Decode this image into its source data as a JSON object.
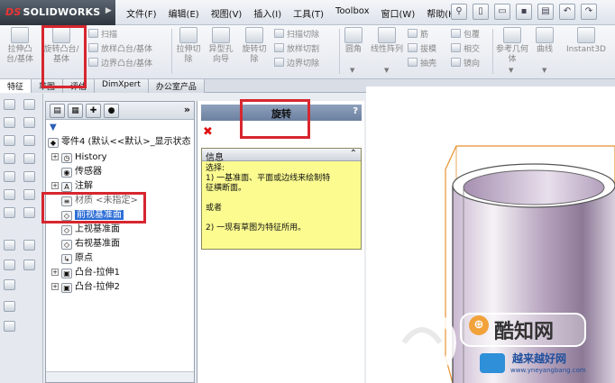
{
  "app": {
    "logo_prefix": "DS",
    "logo_text": "SOLIDWORKS"
  },
  "menu": [
    "文件(F)",
    "编辑(E)",
    "视图(V)",
    "插入(I)",
    "工具(T)",
    "Toolbox",
    "窗口(W)",
    "帮助(H)"
  ],
  "ribbon": {
    "extrude_boss": "拉伸凸台/基体",
    "revolve_boss": "旋转凸台/基体",
    "sweep": "扫描",
    "loft": "放样凸台/基体",
    "boundary_boss": "边界凸台/基体",
    "extrude_cut": "拉伸切除",
    "hole_wizard": "异型孔向导",
    "revolve_cut": "旋转切除",
    "sweep_cut": "扫描切除",
    "loft_cut": "放样切割",
    "boundary_cut": "边界切除",
    "fillet": "圆角",
    "linear_pattern": "线性阵列",
    "rib": "筋",
    "draft": "拔模",
    "shell": "抽壳",
    "wrap": "包覆",
    "intersect": "相交",
    "mirror": "镜向",
    "ref_geometry": "参考几何体",
    "curves": "曲线",
    "instant3d": "Instant3D"
  },
  "tabs": [
    "特征",
    "草图",
    "评估",
    "DimXpert",
    "办公室产品"
  ],
  "feature_manager": {
    "root": "零件4 (默认<<默认>_显示状态",
    "items": [
      {
        "label": "History",
        "icon": "history-icon"
      },
      {
        "label": "传感器",
        "icon": "sensor-icon"
      },
      {
        "label": "注解",
        "icon": "annotation-icon"
      },
      {
        "label": "材质 <未指定>",
        "icon": "material-icon"
      },
      {
        "label": "前视基准面",
        "icon": "plane-icon"
      },
      {
        "label": "上视基准面",
        "icon": "plane-icon"
      },
      {
        "label": "右视基准面",
        "icon": "plane-icon"
      },
      {
        "label": "原点",
        "icon": "origin-icon"
      },
      {
        "label": "凸台-拉伸1",
        "icon": "extrude-icon"
      },
      {
        "label": "凸台-拉伸2",
        "icon": "extrude-icon"
      }
    ]
  },
  "property_panel": {
    "title": "旋转",
    "help": "?",
    "info_title": "信息",
    "info_lines": [
      "选择:",
      "1) 一基准面、平面或边线来绘制特",
      "征横断面。",
      "",
      "或者",
      "",
      "2) 一现有草图为特征所用。"
    ]
  },
  "watermark": {
    "name": "酷知网",
    "url": "www.yneyangbang.com",
    "brand": "越来越好网"
  },
  "colors": {
    "highlight": "#d7262f",
    "selection": "#2f6fd6",
    "info_bg": "#fbfb90",
    "pm_header": "#7f93b2"
  }
}
